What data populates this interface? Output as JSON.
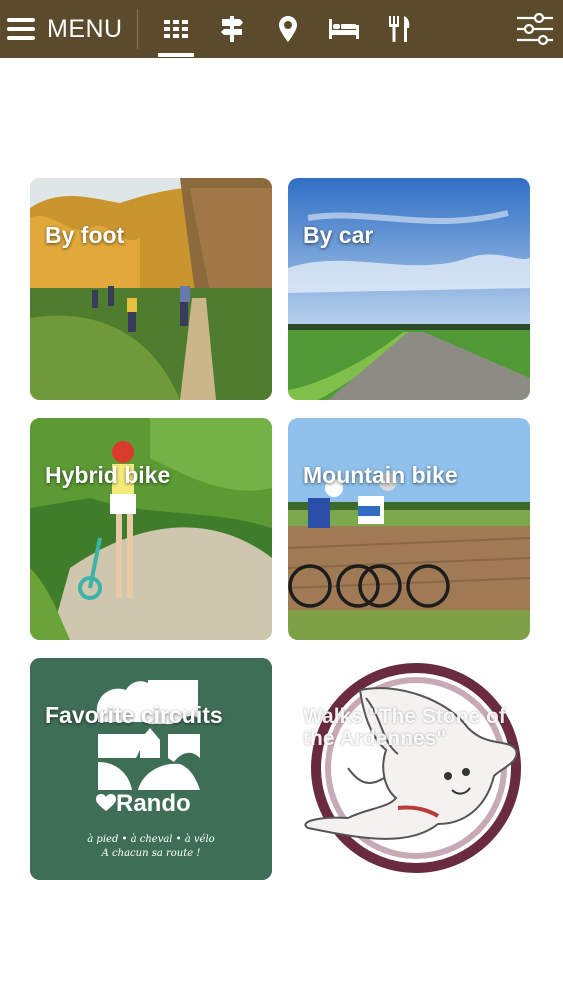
{
  "header": {
    "menu_label": "MENU",
    "nav_icons": [
      "grid-icon",
      "signpost-icon",
      "map-pin-icon",
      "bed-icon",
      "restaurant-icon"
    ],
    "active_nav": "grid-icon",
    "filter_icon": "sliders-icon",
    "bar_color": "#5b4a2c"
  },
  "tiles": [
    {
      "label": "By foot"
    },
    {
      "label": "By car"
    },
    {
      "label": "Hybrid bike"
    },
    {
      "label": "Mountain bike"
    },
    {
      "label": "Favorite circuits"
    },
    {
      "label": "Walks \"The Stone of the Ardennes\""
    }
  ],
  "rando_logo": {
    "title": "Rando",
    "tagline1": "à pied • à cheval • à vélo",
    "tagline2": "A chacun sa route !",
    "color": "#3f6e57"
  }
}
